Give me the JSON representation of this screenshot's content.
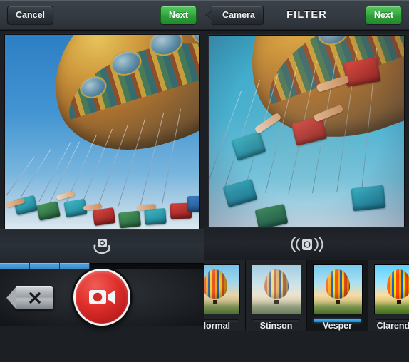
{
  "left_panel": {
    "name": "video-capture-screen",
    "header": {
      "cancel_label": "Cancel",
      "next_label": "Next",
      "title": ""
    },
    "viewfinder": {
      "subject": "carousel-swing-ride",
      "description": "Amusement park swing carousel against blue sky"
    },
    "controls": {
      "flip_camera_icon": "camera-flip-icon"
    },
    "progress": {
      "segments_filled": 3,
      "segments_total": 7,
      "fill_color": "#3f8fd0",
      "track_color": "#0b0d10"
    },
    "capture": {
      "delete_icon": "delete-x-icon",
      "record_icon": "video-camera-icon",
      "record_color": "#d9302c"
    }
  },
  "right_panel": {
    "name": "filter-screen",
    "header": {
      "back_label": "Camera",
      "title": "FILTER",
      "next_label": "Next"
    },
    "preview": {
      "subject": "carousel-swing-ride",
      "description": "Filtered preview of swing carousel, Vesper look"
    },
    "controls": {
      "stabilize_icon": "camera-shake-icon"
    },
    "filters": {
      "selected": "Vesper",
      "selected_color": "#2b9fe5",
      "items": [
        {
          "label": "Normal",
          "style": "f-normal",
          "selected": false
        },
        {
          "label": "Stinson",
          "style": "f-stinson",
          "selected": false
        },
        {
          "label": "Vesper",
          "style": "f-vesper",
          "selected": true
        },
        {
          "label": "Clarendon",
          "style": "f-clarendon",
          "selected": false
        }
      ]
    }
  }
}
